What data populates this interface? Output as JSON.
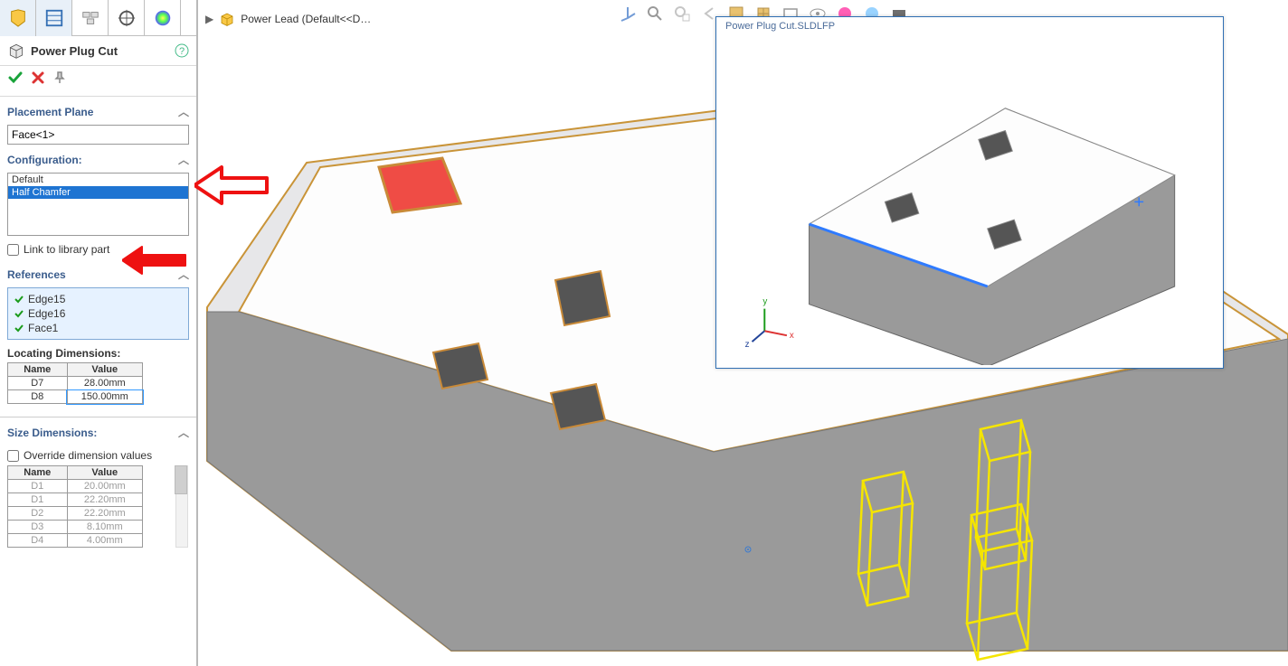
{
  "header": {
    "feature_title": "Power Plug Cut",
    "breadcrumb_label": "Power Lead  (Default<<D…"
  },
  "placement_plane": {
    "label": "Placement Plane",
    "value": "Face<1>"
  },
  "configuration": {
    "label": "Configuration:",
    "options": [
      "Default",
      "Half Chamfer"
    ],
    "selected_index": 1
  },
  "link_checkbox": {
    "label": "Link to library part",
    "checked": false
  },
  "references": {
    "label": "References",
    "items": [
      "Edge15",
      "Edge16",
      "Face1"
    ]
  },
  "locating_dims": {
    "label": "Locating Dimensions:",
    "columns": [
      "Name",
      "Value"
    ],
    "rows": [
      {
        "name": "D7",
        "value": "28.00mm",
        "editable": true
      },
      {
        "name": "D8",
        "value": "150.00mm",
        "editable": true
      }
    ]
  },
  "size_dims": {
    "label": "Size Dimensions:",
    "override_label": "Override dimension values",
    "override_checked": false,
    "columns": [
      "Name",
      "Value"
    ],
    "rows": [
      {
        "name": "D1",
        "value": "20.00mm"
      },
      {
        "name": "D1",
        "value": "22.20mm"
      },
      {
        "name": "D2",
        "value": "22.20mm"
      },
      {
        "name": "D3",
        "value": "8.10mm"
      },
      {
        "name": "D4",
        "value": "4.00mm"
      }
    ]
  },
  "preview": {
    "title": "Power Plug Cut.SLDLFP"
  },
  "tab_icons": [
    "feature-tree-icon",
    "property-manager-icon",
    "config-manager-icon",
    "dimxpert-icon",
    "display-manager-icon"
  ],
  "toolbar_icons": [
    "triad-icon",
    "zoom-fit-icon",
    "zoom-area-icon",
    "prev-view-icon",
    "section-icon",
    "view-orient-icon",
    "display-style-icon",
    "hide-show-icon",
    "edit-appearance-icon",
    "apply-scene-icon",
    "view-settings-icon"
  ]
}
